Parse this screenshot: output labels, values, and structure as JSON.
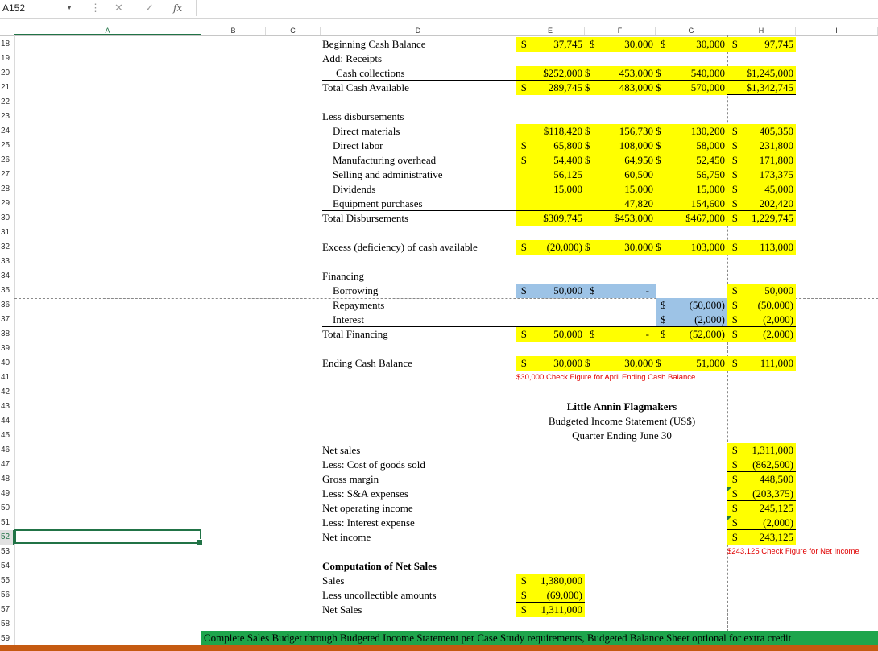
{
  "formula_bar": {
    "name_box": "A152",
    "cancel_icon": "✕",
    "enter_icon": "✓",
    "fx_icon": "fx",
    "more_icon": "⋮",
    "formula_value": ""
  },
  "columns": [
    "A",
    "B",
    "C",
    "D",
    "E",
    "F",
    "G",
    "H",
    "I"
  ],
  "rows": [
    "18",
    "19",
    "20",
    "21",
    "22",
    "23",
    "24",
    "25",
    "26",
    "27",
    "28",
    "29",
    "30",
    "31",
    "32",
    "33",
    "34",
    "35",
    "36",
    "37",
    "38",
    "39",
    "40",
    "41",
    "42",
    "43",
    "44",
    "45",
    "46",
    "47",
    "48",
    "49",
    "50",
    "51",
    "52",
    "53",
    "54",
    "55",
    "56",
    "57",
    "58",
    "59"
  ],
  "cash_budget": {
    "beginning": {
      "label": "Beginning Cash Balance",
      "e": "37,745",
      "f": "30,000",
      "g": "30,000",
      "h": "97,745"
    },
    "receipts_label": "Add: Receipts",
    "collections": {
      "label": "Cash collections",
      "e": "$252,000",
      "f": "453,000",
      "g": "540,000",
      "h": "$1,245,000"
    },
    "total_available": {
      "label": "Total Cash Available",
      "e": "289,745",
      "f": "483,000",
      "g": "570,000",
      "h": "$1,342,745"
    },
    "disb_label": "Less disbursements",
    "disbursements": [
      {
        "label": "Direct materials",
        "e": "$118,420",
        "f": "156,730",
        "g": "130,200",
        "h": "405,350"
      },
      {
        "label": "Direct labor",
        "e": "65,800",
        "f": "108,000",
        "g": "58,000",
        "h": "231,800"
      },
      {
        "label": "Manufacturing overhead",
        "e": "54,400",
        "f": "64,950",
        "g": "52,450",
        "h": "171,800"
      },
      {
        "label": "Selling and administrative",
        "e": "56,125",
        "f": "60,500",
        "g": "56,750",
        "h": "173,375"
      },
      {
        "label": "Dividends",
        "e": "15,000",
        "f": "15,000",
        "g": "15,000",
        "h": "45,000"
      },
      {
        "label": "Equipment purchases",
        "e": "",
        "f": "47,820",
        "g": "154,600",
        "h": "202,420"
      }
    ],
    "total_disb": {
      "label": "Total Disbursements",
      "e": "$309,745",
      "f": "$453,000",
      "g": "$467,000",
      "h": "1,229,745"
    },
    "excess": {
      "label": "Excess (deficiency) of cash available",
      "e": "(20,000)",
      "f": "30,000",
      "g": "103,000",
      "h": "113,000"
    },
    "financing_label": "Financing",
    "borrowing": {
      "label": "Borrowing",
      "e": "50,000",
      "f": "-",
      "h": "50,000"
    },
    "repayments": {
      "label": "Repayments",
      "g": "(50,000)",
      "h": "(50,000)"
    },
    "interest": {
      "label": "Interest",
      "g": "(2,000)",
      "h": "(2,000)"
    },
    "total_financing": {
      "label": "Total Financing",
      "e": "50,000",
      "f": "-",
      "g": "(52,000)",
      "h": "(2,000)"
    },
    "ending": {
      "label": "Ending Cash Balance",
      "e": "30,000",
      "f": "30,000",
      "g": "51,000",
      "h": "111,000"
    },
    "check_april": "$30,000 Check Figure for April Ending Cash Balance"
  },
  "income_statement": {
    "company": "Little Annin Flagmakers",
    "title": "Budgeted Income Statement (US$)",
    "period": "Quarter Ending June 30",
    "lines": [
      {
        "label": "Net sales",
        "h": "1,311,000"
      },
      {
        "label": "Less: Cost of goods sold",
        "h": "(862,500)"
      },
      {
        "label": "Gross margin",
        "h": "448,500"
      },
      {
        "label": "Less: S&A expenses",
        "h": "(203,375)"
      },
      {
        "label": "Net operating income",
        "h": "245,125"
      },
      {
        "label": "Less: Interest expense",
        "h": "(2,000)"
      },
      {
        "label": "Net income",
        "h": "243,125"
      }
    ],
    "check_net_income": "$243,125 Check Figure for Net Income"
  },
  "net_sales_comp": {
    "title": "Computation of Net Sales",
    "sales": {
      "label": "Sales",
      "e": "1,380,000"
    },
    "uncollectible": {
      "label": "Less uncollectible amounts",
      "e": "(69,000)"
    },
    "net": {
      "label": "Net Sales",
      "e": "1,311,000"
    }
  },
  "footer_note": "Complete Sales Budget through Budgeted Income Statement per Case Study requirements, Budgeted Balance Sheet optional for extra credit",
  "dollar": "$"
}
